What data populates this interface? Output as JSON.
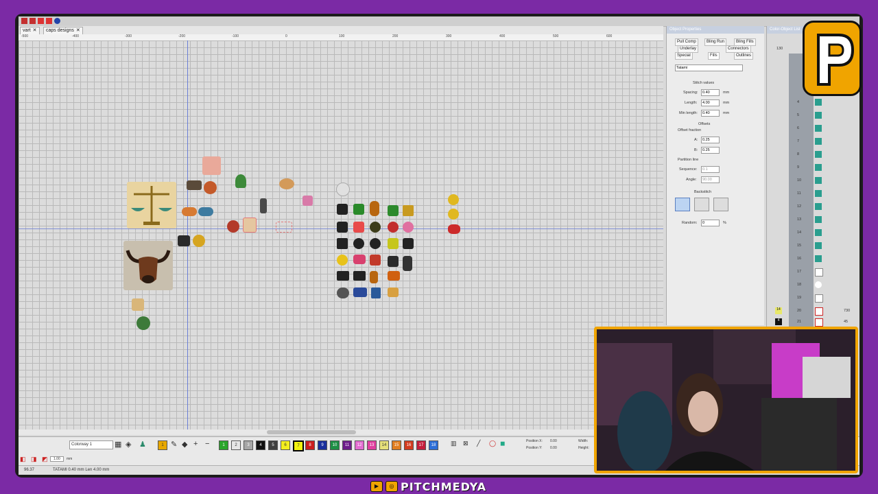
{
  "tabs": [
    {
      "label": "vart"
    },
    {
      "label": "caps designs"
    }
  ],
  "ruler_marks": [
    "-500",
    "-400",
    "-300",
    "-200",
    "-100",
    "0",
    "100",
    "200",
    "300",
    "400",
    "500",
    "600"
  ],
  "object_properties": {
    "title": "Object Properties",
    "tabs_row1": [
      "Pull Comp",
      "Bling Run",
      "Bling Fills"
    ],
    "tabs_row2": [
      "Underlay",
      "Connectors"
    ],
    "tabs_row3": [
      "Special",
      "Fills",
      "Outlines"
    ],
    "fill_type": "Tatami",
    "stitch_values_label": "Stitch values",
    "spacing_label": "Spacing:",
    "spacing_value": "0.40",
    "spacing_unit": "mm",
    "length_label": "Length:",
    "length_value": "4.00",
    "length_unit": "mm",
    "min_length_label": "Min length:",
    "min_length_value": "0.40",
    "min_length_unit": "mm",
    "offsets_label": "Offsets",
    "offset_fraction_label": "Offset fraction",
    "a_label": "A:",
    "a_value": "0.25",
    "b_label": "B:",
    "b_value": "0.25",
    "partition_line_label": "Partition line",
    "sequence_label": "Sequence:",
    "sequence_value": "0.1",
    "angle_label": "Angle:",
    "angle_value": "90.00",
    "backstitch_label": "Backstitch",
    "random_label": "Random:",
    "random_value": "0",
    "random_unit": "%"
  },
  "color_object_list": {
    "title": "Color-Object List",
    "header_value": "130",
    "rows": [
      "4",
      "5",
      "6",
      "7",
      "8",
      "9",
      "10",
      "11",
      "12",
      "13",
      "14",
      "15",
      "16",
      "17",
      "18",
      "19",
      "20",
      "21"
    ],
    "row20_count": "730",
    "row21_count": "45",
    "badge_14": "14",
    "badge_4": "4"
  },
  "toolbar": {
    "colorway": "Colorway 1",
    "swatches": [
      {
        "n": "1",
        "color": "#e8a800"
      },
      {
        "n": "1",
        "color": "#2aa52a"
      },
      {
        "n": "2",
        "color": "#e6e6e6"
      },
      {
        "n": "3",
        "color": "#a7a7a7"
      },
      {
        "n": "4",
        "color": "#111111"
      },
      {
        "n": "5",
        "color": "#404040"
      },
      {
        "n": "6",
        "color": "#f3ee1e"
      },
      {
        "n": "7",
        "color": "#f2f20f"
      },
      {
        "n": "8",
        "color": "#cc1e1e"
      },
      {
        "n": "9",
        "color": "#1a2f9c"
      },
      {
        "n": "10",
        "color": "#1e8f45"
      },
      {
        "n": "11",
        "color": "#6d1e8a"
      },
      {
        "n": "12",
        "color": "#e26cd0"
      },
      {
        "n": "13",
        "color": "#e03fa0"
      },
      {
        "n": "14",
        "color": "#e6e07a"
      },
      {
        "n": "15",
        "color": "#e07d20"
      },
      {
        "n": "16",
        "color": "#d23c1f"
      },
      {
        "n": "17",
        "color": "#c41f3c"
      },
      {
        "n": "18",
        "color": "#2d6ed6"
      }
    ],
    "position_x_label": "Position X:",
    "position_y_label": "Position Y:",
    "position_x_value": "0.00",
    "position_y_value": "0.00",
    "width_label": "Width:",
    "height_label": "Height:",
    "size_value": "1.00",
    "size_unit": "mm"
  },
  "status": {
    "left": "96.37",
    "text": "TATAMI 0.40 mm Len 4.00 mm"
  },
  "footer": {
    "brand": "PITCHMEDYA"
  },
  "colors": {
    "frame": "#7b2aa5",
    "accent": "#f0a400",
    "axis": "#6b7fd6"
  }
}
